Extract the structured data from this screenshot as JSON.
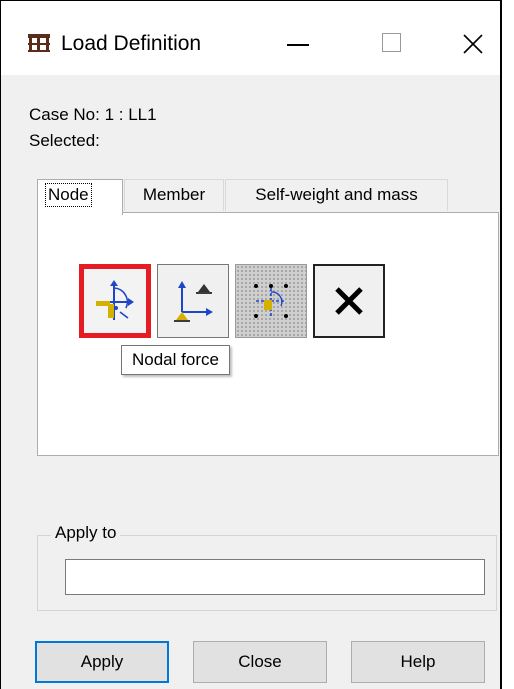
{
  "window": {
    "title": "Load Definition",
    "icon": "structure-icon"
  },
  "info": {
    "case_label": "Case No: 1 : LL1",
    "selected_label": "Selected:"
  },
  "tabs": [
    {
      "label": "Node",
      "active": true
    },
    {
      "label": "Member",
      "active": false
    },
    {
      "label": "Self-weight and mass",
      "active": false
    }
  ],
  "tools": [
    {
      "name": "nodal-force-icon",
      "selected": true
    },
    {
      "name": "nodal-support-displacement-icon",
      "selected": false
    },
    {
      "name": "multiple-node-load-icon",
      "selected": false
    },
    {
      "name": "delete-load-icon",
      "selected": false
    }
  ],
  "tooltip": {
    "text": "Nodal force"
  },
  "apply_to": {
    "label": "Apply to",
    "value": ""
  },
  "buttons": {
    "apply": "Apply",
    "close": "Close",
    "help": "Help"
  },
  "colors": {
    "highlight": "#e51c23",
    "default_button_border": "#0078d7"
  }
}
